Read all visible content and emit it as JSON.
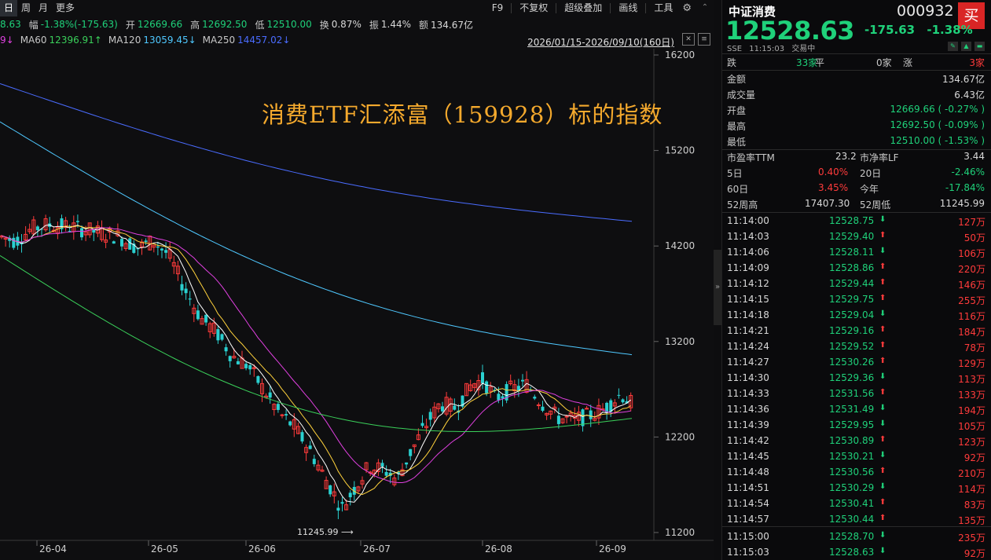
{
  "toolbar": {
    "left": [
      "日",
      "周",
      "月",
      "更多"
    ],
    "right": [
      "F9",
      "不复权",
      "超级叠加",
      "画线",
      "工具"
    ]
  },
  "quote_line": {
    "partial": "8.63",
    "amp_label": "幅",
    "amp_value": "-1.38%(-175.63)",
    "open_label": "开",
    "open_value": "12669.66",
    "high_label": "高",
    "high_value": "12692.50",
    "low_label": "低",
    "low_value": "12510.00",
    "turn_label": "换",
    "turn_value": "0.87%",
    "swing_label": "振",
    "swing_value": "1.44%",
    "amt_label": "额",
    "amt_value": "134.67亿"
  },
  "ma_line": {
    "partial": "9↓",
    "ma60": "MA60",
    "ma60_value": "12396.91↑",
    "ma120": "MA120",
    "ma120_value": "13059.45↓",
    "ma250": "MA250",
    "ma250_value": "14457.02↓",
    "range": "2026/01/15-2026/09/10(160日)"
  },
  "overlay_title": "消费ETF汇添富（159928）标的指数",
  "low_marker": "11245.99",
  "colors": {
    "up": "#ff3b3b",
    "down": "#2ad0d0",
    "green": "#1fd17a",
    "ma5": "#ffffff",
    "ma10": "#ffd23c",
    "ma20": "#e040e0",
    "ma60": "#3ad05a",
    "ma120": "#4fc8ff",
    "ma250": "#4a6cff",
    "title": "#f4a92d"
  },
  "chart_data": {
    "type": "candlestick",
    "y_ticks": [
      16200,
      15200,
      14200,
      13200,
      12200,
      11200
    ],
    "ylim": [
      11150,
      16300
    ],
    "x_ticks": [
      "26-04",
      "26-05",
      "26-06",
      "26-07",
      "26-08",
      "26-09"
    ],
    "ma_series": [
      {
        "name": "MA60",
        "start": 14100,
        "end": 12396.91
      },
      {
        "name": "MA120",
        "start": 15500,
        "end": 13059.45
      },
      {
        "name": "MA250",
        "start": 15900,
        "end": 14457.02
      }
    ]
  },
  "side": {
    "name": "中证消费",
    "code": "000932",
    "buy": "买",
    "price": "12528.63",
    "change": "-175.63",
    "change_pct": "-1.38%",
    "sub": [
      "SSE",
      "11:15:03",
      "交易中"
    ],
    "breadth": {
      "fall_label": "跌",
      "fall_value": "33家",
      "flat_label": "平",
      "flat_value": "0家",
      "rise_label": "涨",
      "rise_value": "3家"
    },
    "stats": [
      {
        "label": "金额",
        "value": "134.67亿"
      },
      {
        "label": "成交量",
        "value": "6.43亿"
      },
      {
        "label": "开盘",
        "value": "12669.66 ( -0.27% )"
      },
      {
        "label": "最高",
        "value": "12692.50 ( -0.09% )"
      },
      {
        "label": "最低",
        "value": "12510.00 ( -1.53% )"
      }
    ],
    "valuation": {
      "pe_label": "市盈率TTM",
      "pe_value": "23.2",
      "pb_label": "市净率LF",
      "pb_value": "3.44",
      "d5_label": "5日",
      "d5_value": "0.40%",
      "d20_label": "20日",
      "d20_value": "-2.46%",
      "d60_label": "60日",
      "d60_value": "3.45%",
      "ytd_label": "今年",
      "ytd_value": "-17.84%",
      "h52_label": "52周高",
      "h52_value": "17407.30",
      "l52_label": "52周低",
      "l52_value": "11245.99"
    },
    "ticks": [
      {
        "time": "11:14:00",
        "price": "12528.75",
        "dir": "down",
        "vol": "127万"
      },
      {
        "time": "11:14:03",
        "price": "12529.40",
        "dir": "up",
        "vol": "50万"
      },
      {
        "time": "11:14:06",
        "price": "12528.11",
        "dir": "down",
        "vol": "106万"
      },
      {
        "time": "11:14:09",
        "price": "12528.86",
        "dir": "up",
        "vol": "220万"
      },
      {
        "time": "11:14:12",
        "price": "12529.44",
        "dir": "up",
        "vol": "146万"
      },
      {
        "time": "11:14:15",
        "price": "12529.75",
        "dir": "up",
        "vol": "255万"
      },
      {
        "time": "11:14:18",
        "price": "12529.04",
        "dir": "down",
        "vol": "116万"
      },
      {
        "time": "11:14:21",
        "price": "12529.16",
        "dir": "up",
        "vol": "184万"
      },
      {
        "time": "11:14:24",
        "price": "12529.52",
        "dir": "up",
        "vol": "78万"
      },
      {
        "time": "11:14:27",
        "price": "12530.26",
        "dir": "up",
        "vol": "129万"
      },
      {
        "time": "11:14:30",
        "price": "12529.36",
        "dir": "down",
        "vol": "113万"
      },
      {
        "time": "11:14:33",
        "price": "12531.56",
        "dir": "up",
        "vol": "133万"
      },
      {
        "time": "11:14:36",
        "price": "12531.49",
        "dir": "down",
        "vol": "194万"
      },
      {
        "time": "11:14:39",
        "price": "12529.95",
        "dir": "down",
        "vol": "105万"
      },
      {
        "time": "11:14:42",
        "price": "12530.89",
        "dir": "up",
        "vol": "123万"
      },
      {
        "time": "11:14:45",
        "price": "12530.21",
        "dir": "down",
        "vol": "92万"
      },
      {
        "time": "11:14:48",
        "price": "12530.56",
        "dir": "up",
        "vol": "210万"
      },
      {
        "time": "11:14:51",
        "price": "12530.29",
        "dir": "down",
        "vol": "114万"
      },
      {
        "time": "11:14:54",
        "price": "12530.41",
        "dir": "up",
        "vol": "83万"
      },
      {
        "time": "11:14:57",
        "price": "12530.44",
        "dir": "up",
        "vol": "135万"
      },
      {
        "time": "11:15:00",
        "price": "12528.70",
        "dir": "down",
        "vol": "235万"
      },
      {
        "time": "11:15:03",
        "price": "12528.63",
        "dir": "down",
        "vol": "92万"
      }
    ]
  }
}
